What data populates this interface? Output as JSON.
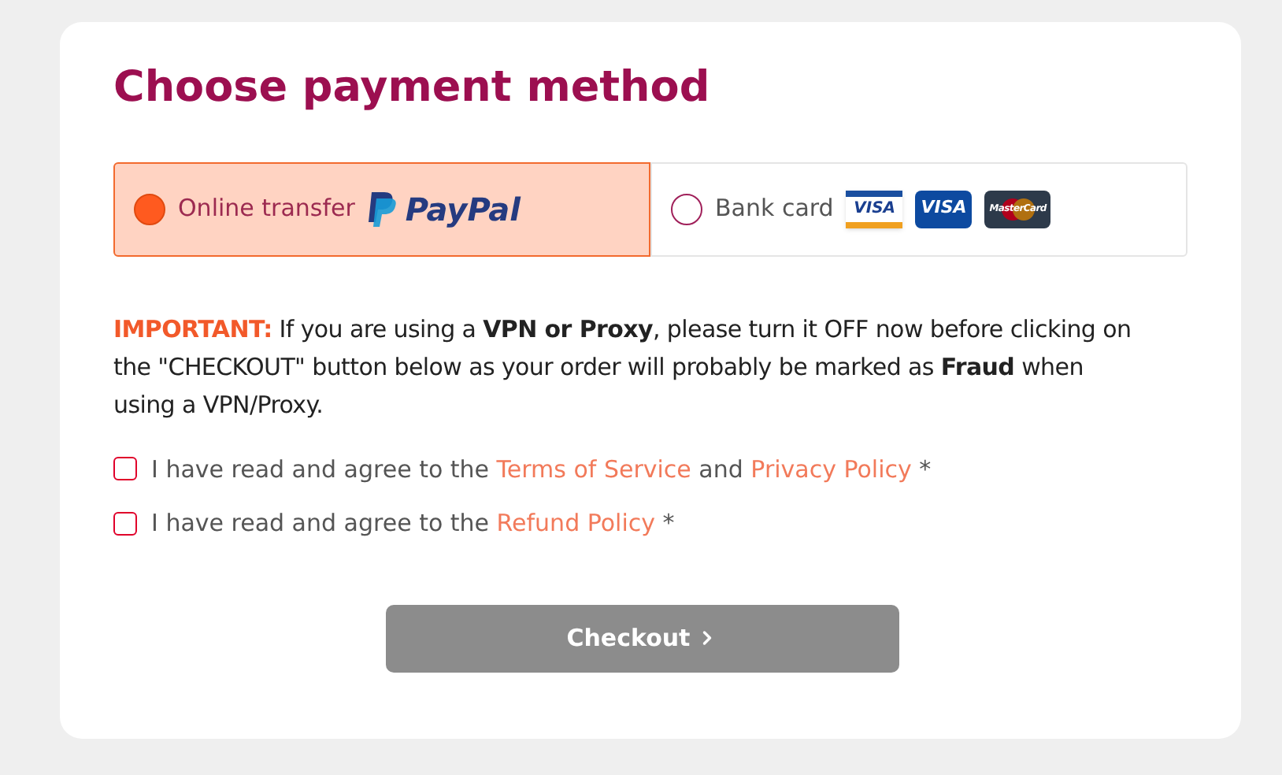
{
  "title": "Choose payment method",
  "methods": [
    {
      "label": "Online transfer",
      "selected": true,
      "logos": [
        {
          "kind": "paypal",
          "text": "PayPal"
        }
      ]
    },
    {
      "label": "Bank card",
      "selected": false,
      "logos": [
        {
          "kind": "visa-light",
          "text": "VISA"
        },
        {
          "kind": "visa-dark",
          "text": "VISA"
        },
        {
          "kind": "mastercard",
          "text": "MasterCard"
        }
      ]
    }
  ],
  "notice": {
    "label": "IMPORTANT:",
    "text": "If you are using a **VPN or Proxy**, please turn it OFF now before clicking on the \"CHECKOUT\" button below as your order will probably be marked as **Fraud** when using a VPN/Proxy."
  },
  "agreements": [
    {
      "checked": false,
      "parts": [
        {
          "kind": "text",
          "text": "I have read and agree to the "
        },
        {
          "kind": "link",
          "text": "Terms of Service"
        },
        {
          "kind": "text",
          "text": " and "
        },
        {
          "kind": "link",
          "text": "Privacy Policy"
        },
        {
          "kind": "text",
          "text": " *"
        }
      ]
    },
    {
      "checked": false,
      "parts": [
        {
          "kind": "text",
          "text": "I have read and agree to the "
        },
        {
          "kind": "link",
          "text": "Refund Policy"
        },
        {
          "kind": "text",
          "text": " *"
        }
      ]
    }
  ],
  "checkout_button": {
    "label": "Checkout",
    "disabled": true
  }
}
